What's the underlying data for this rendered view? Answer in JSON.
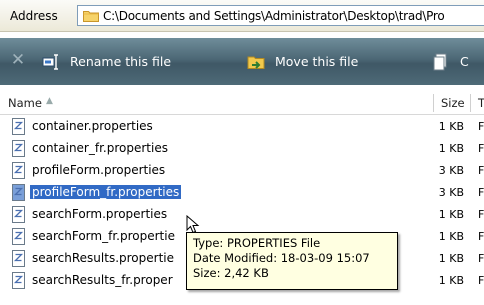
{
  "address_bar": {
    "label": "Address",
    "path": "C:\\Documents and Settings\\Administrator\\Desktop\\trad\\Pro",
    "folder_icon": "folder-icon"
  },
  "toolbar": {
    "close_icon": "close-icon",
    "rename_label": "Rename this file",
    "move_label": "Move this file",
    "more_label": "C"
  },
  "columns": {
    "name": "Name",
    "size": "Size",
    "type": "T"
  },
  "files": [
    {
      "name": "container.properties",
      "size": "1 KB",
      "type": "F"
    },
    {
      "name": "container_fr.properties",
      "size": "1 KB",
      "type": "F"
    },
    {
      "name": "profileForm.properties",
      "size": "3 KB",
      "type": "F"
    },
    {
      "name": "profileForm_fr.properties",
      "size": "3 KB",
      "type": "F",
      "selected": true
    },
    {
      "name": "searchForm.properties",
      "size": "1 KB",
      "type": "F"
    },
    {
      "name": "searchForm_fr.propertie",
      "size": "1 KB",
      "type": "F"
    },
    {
      "name": "searchResults.propertie",
      "size": "1 KB",
      "type": "F"
    },
    {
      "name": "searchResults_fr.proper",
      "size": "1 KB",
      "type": "F"
    }
  ],
  "tooltip": {
    "type_line": "Type: PROPERTIES File",
    "date_line": "Date Modified: 18-03-09 15:07",
    "size_line": "Size: 2,42 KB"
  },
  "colors": {
    "toolbar": "#4c6775",
    "selection": "#316ac5",
    "tooltip_bg": "#ffffe1"
  }
}
